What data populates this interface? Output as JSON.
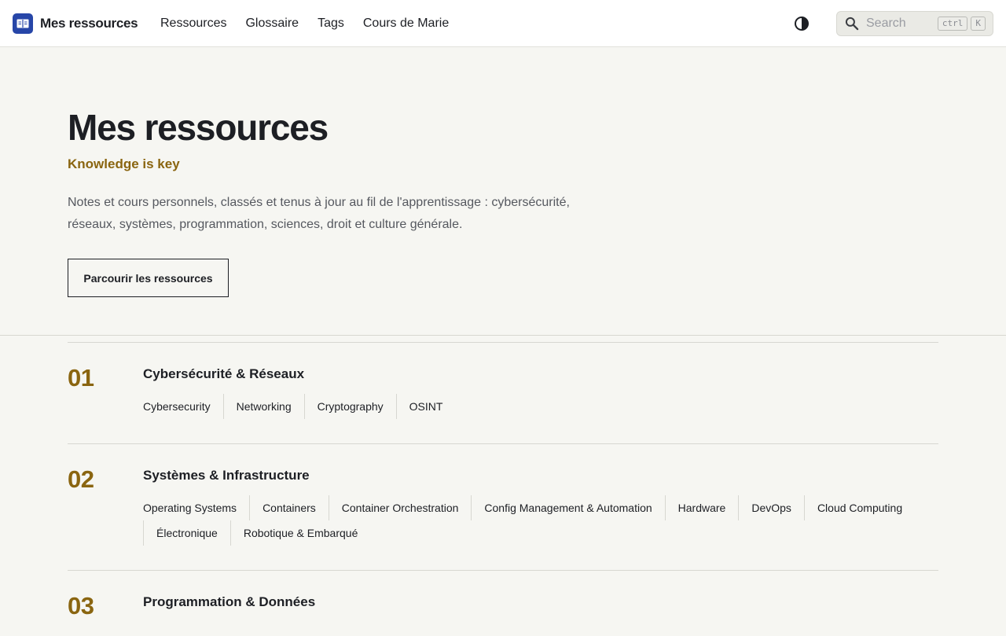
{
  "header": {
    "brand": "Mes ressources",
    "nav": [
      "Ressources",
      "Glossaire",
      "Tags",
      "Cours de Marie"
    ],
    "search_placeholder": "Search",
    "shortcut_keys": [
      "ctrl",
      "K"
    ],
    "theme_icon": "half-circle-contrast-icon",
    "logo_icon": "book-icon"
  },
  "hero": {
    "title": "Mes ressources",
    "subtitle": "Knowledge is key",
    "description": "Notes et cours personnels, classés et tenus à jour au fil de l'apprentissage : cybersécurité, réseaux, systèmes, programmation, sciences, droit et culture générale.",
    "cta": "Parcourir les ressources"
  },
  "colors": {
    "accent": "#8a6510",
    "brand_logo": "#2746a8",
    "background": "#f6f6f2"
  },
  "categories": [
    {
      "number": "01",
      "title": "Cybersécurité & Réseaux",
      "tags": [
        "Cybersecurity",
        "Networking",
        "Cryptography",
        "OSINT"
      ]
    },
    {
      "number": "02",
      "title": "Systèmes & Infrastructure",
      "tags": [
        "Operating Systems",
        "Containers",
        "Container Orchestration",
        "Config Management & Automation",
        "Hardware",
        "DevOps",
        "Cloud Computing",
        "Électronique",
        "Robotique & Embarqué"
      ]
    },
    {
      "number": "03",
      "title": "Programmation & Données",
      "tags": []
    }
  ]
}
